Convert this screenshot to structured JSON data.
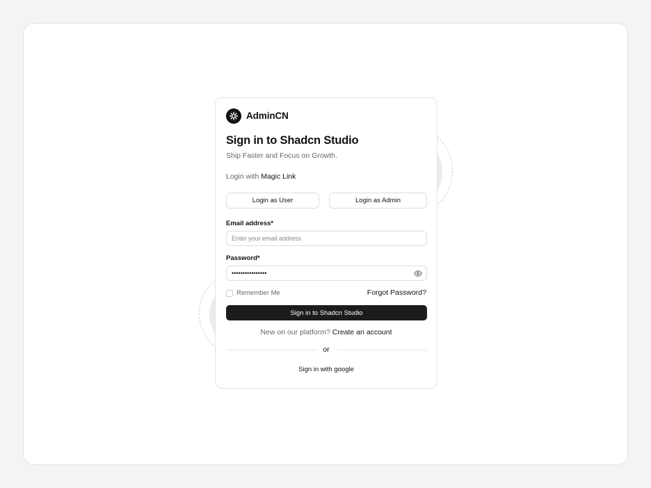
{
  "brand": {
    "name": "AdminCN",
    "logo_icon": "asterisk-logo-icon"
  },
  "header": {
    "title": "Sign in to Shadcn Studio",
    "subtitle": "Ship Faster and Focus on Growth."
  },
  "magic_link": {
    "prefix": "Login with",
    "link_label": "Magic Link"
  },
  "quick_login": {
    "user_label": "Login as User",
    "admin_label": "Login as Admin"
  },
  "form": {
    "email": {
      "label": "Email address*",
      "placeholder": "Enter your email address",
      "value": ""
    },
    "password": {
      "label": "Password*",
      "value": "••••••••••••••••",
      "toggle_icon": "eye-icon"
    },
    "remember_label": "Remember Me",
    "remember_checked": false,
    "forgot_label": "Forgot Password?",
    "submit_label": "Sign in to Shadcn Studio"
  },
  "signup": {
    "prefix": "New on our platform?",
    "link_label": "Create an account"
  },
  "divider_label": "or",
  "social": {
    "google_label": "Sign in with google"
  },
  "colors": {
    "primary": "#1c1c1c",
    "muted_text": "#666666",
    "border": "#dedede",
    "page_bg": "#f4f4f4"
  }
}
